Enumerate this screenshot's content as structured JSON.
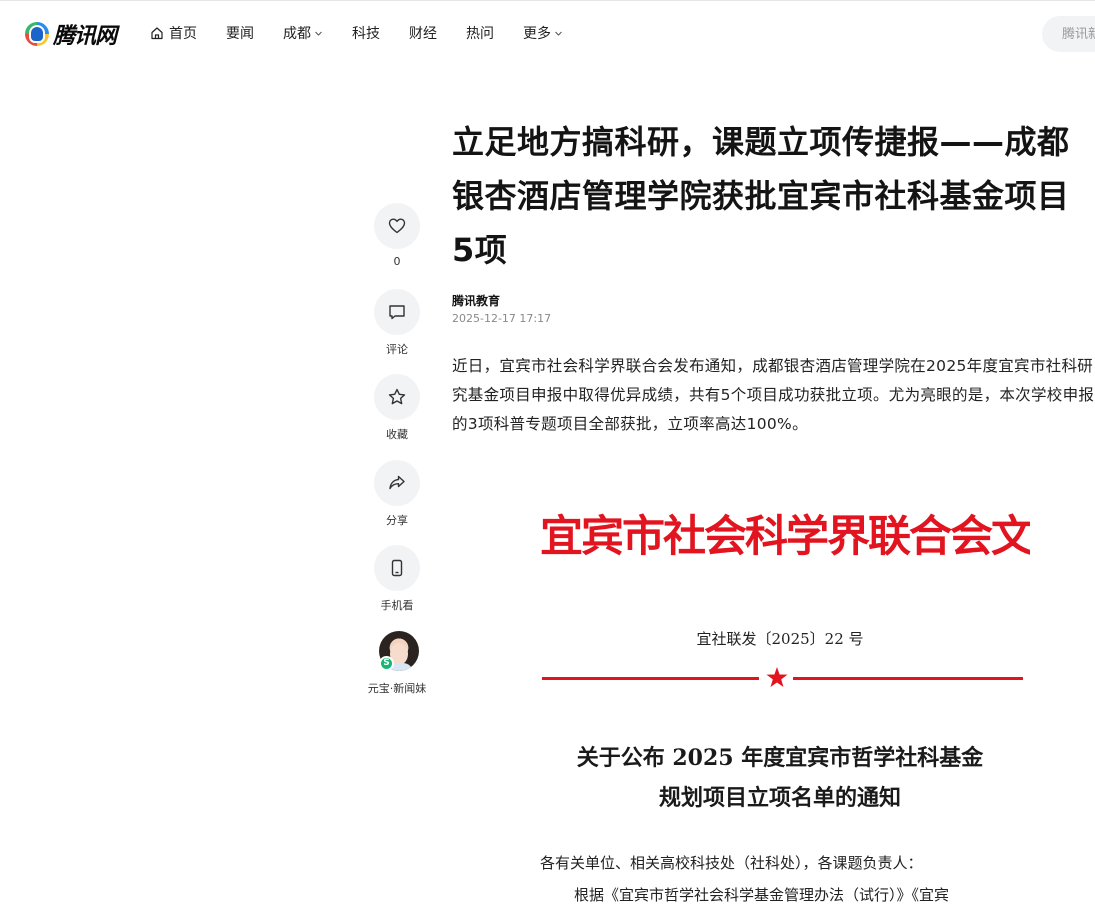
{
  "header": {
    "logo_text": "腾讯网",
    "nav": [
      {
        "label": "首页",
        "icon": "home-icon"
      },
      {
        "label": "要闻"
      },
      {
        "label": "成都",
        "dropdown": true
      },
      {
        "label": "科技"
      },
      {
        "label": "财经"
      },
      {
        "label": "热问"
      },
      {
        "label": "更多",
        "dropdown": true
      }
    ],
    "search_placeholder": "腾讯新闻"
  },
  "rail": {
    "like_count": "0",
    "comment_label": "评论",
    "favorite_label": "收藏",
    "share_label": "分享",
    "mobile_label": "手机看",
    "assistant_label": "元宝·新闻妹"
  },
  "article": {
    "title": "立足地方搞科研，课题立项传捷报——成都银杏酒店管理学院获批宜宾市社科基金项目5项",
    "author": "腾讯教育",
    "date": "2025-12-17 17:17",
    "lead": "近日，宜宾市社会科学界联合会发布通知，成都银杏酒店管理学院在2025年度宜宾市社科研究基金项目申报中取得优异成绩，共有5个项目成功获批立项。尤为亮眼的是，本次学校申报的3项科普专题项目全部获批，立项率高达100%。"
  },
  "document": {
    "header": "宜宾市社会科学界联合会文件",
    "number": "宜社联发〔2025〕22 号",
    "title_line1": "关于公布 2025 年度宜宾市哲学社科基金",
    "title_line2": "规划项目立项名单的通知",
    "body_line1": "各有关单位、相关高校科技处（社科处），各课题负责人：",
    "body_line2": "根据《宜宾市哲学社会科学基金管理办法（试行）》《宜宾"
  },
  "colors": {
    "accent_red": "#e2141f",
    "rail_bg": "#f2f3f5",
    "text_primary": "#141414",
    "text_muted": "#8a8a8a"
  }
}
